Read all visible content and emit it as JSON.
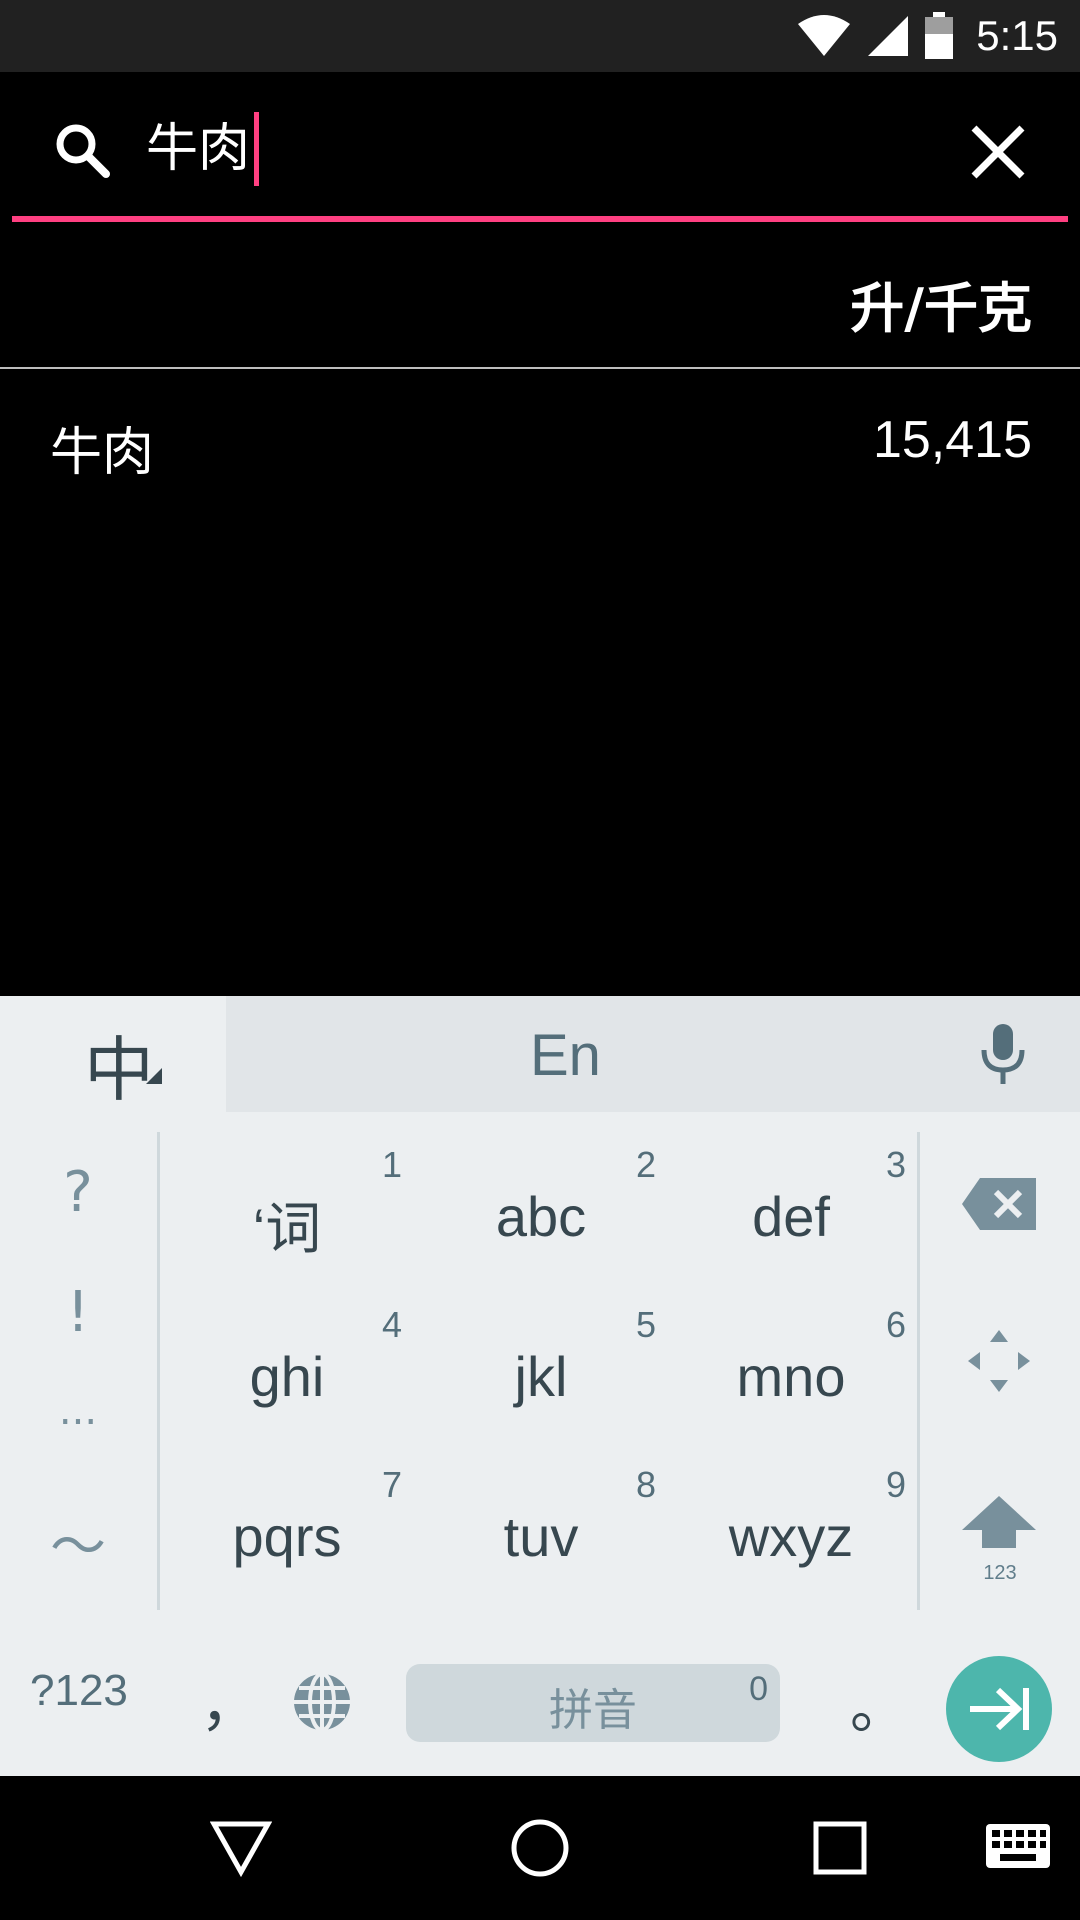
{
  "status_bar": {
    "time": "5:15",
    "icons": [
      "wifi-icon",
      "signal-icon",
      "battery-icon"
    ]
  },
  "search": {
    "query": "牛肉",
    "accent_color": "#ff4081"
  },
  "table": {
    "unit_header": "升/千克",
    "rows": [
      {
        "name": "牛肉",
        "value": "15,415"
      }
    ]
  },
  "keyboard": {
    "lang_zh": "中",
    "lang_en": "En",
    "symbols": [
      "?",
      "!",
      "...",
      "～"
    ],
    "keys": [
      {
        "label": "‘词",
        "num": "1"
      },
      {
        "label": "abc",
        "num": "2"
      },
      {
        "label": "def",
        "num": "3"
      },
      {
        "label": "ghi",
        "num": "4"
      },
      {
        "label": "jkl",
        "num": "5"
      },
      {
        "label": "mno",
        "num": "6"
      },
      {
        "label": "pqrs",
        "num": "7"
      },
      {
        "label": "tuv",
        "num": "8"
      },
      {
        "label": "wxyz",
        "num": "9"
      }
    ],
    "shift_sub": "123",
    "mode_key": "?123",
    "comma": "，",
    "space_label": "拼音",
    "space_num": "0",
    "period": "。",
    "enter_color": "#4db6ac"
  },
  "nav_bar": {
    "icons": [
      "back-icon",
      "home-icon",
      "recents-icon",
      "keyboard-icon"
    ]
  }
}
